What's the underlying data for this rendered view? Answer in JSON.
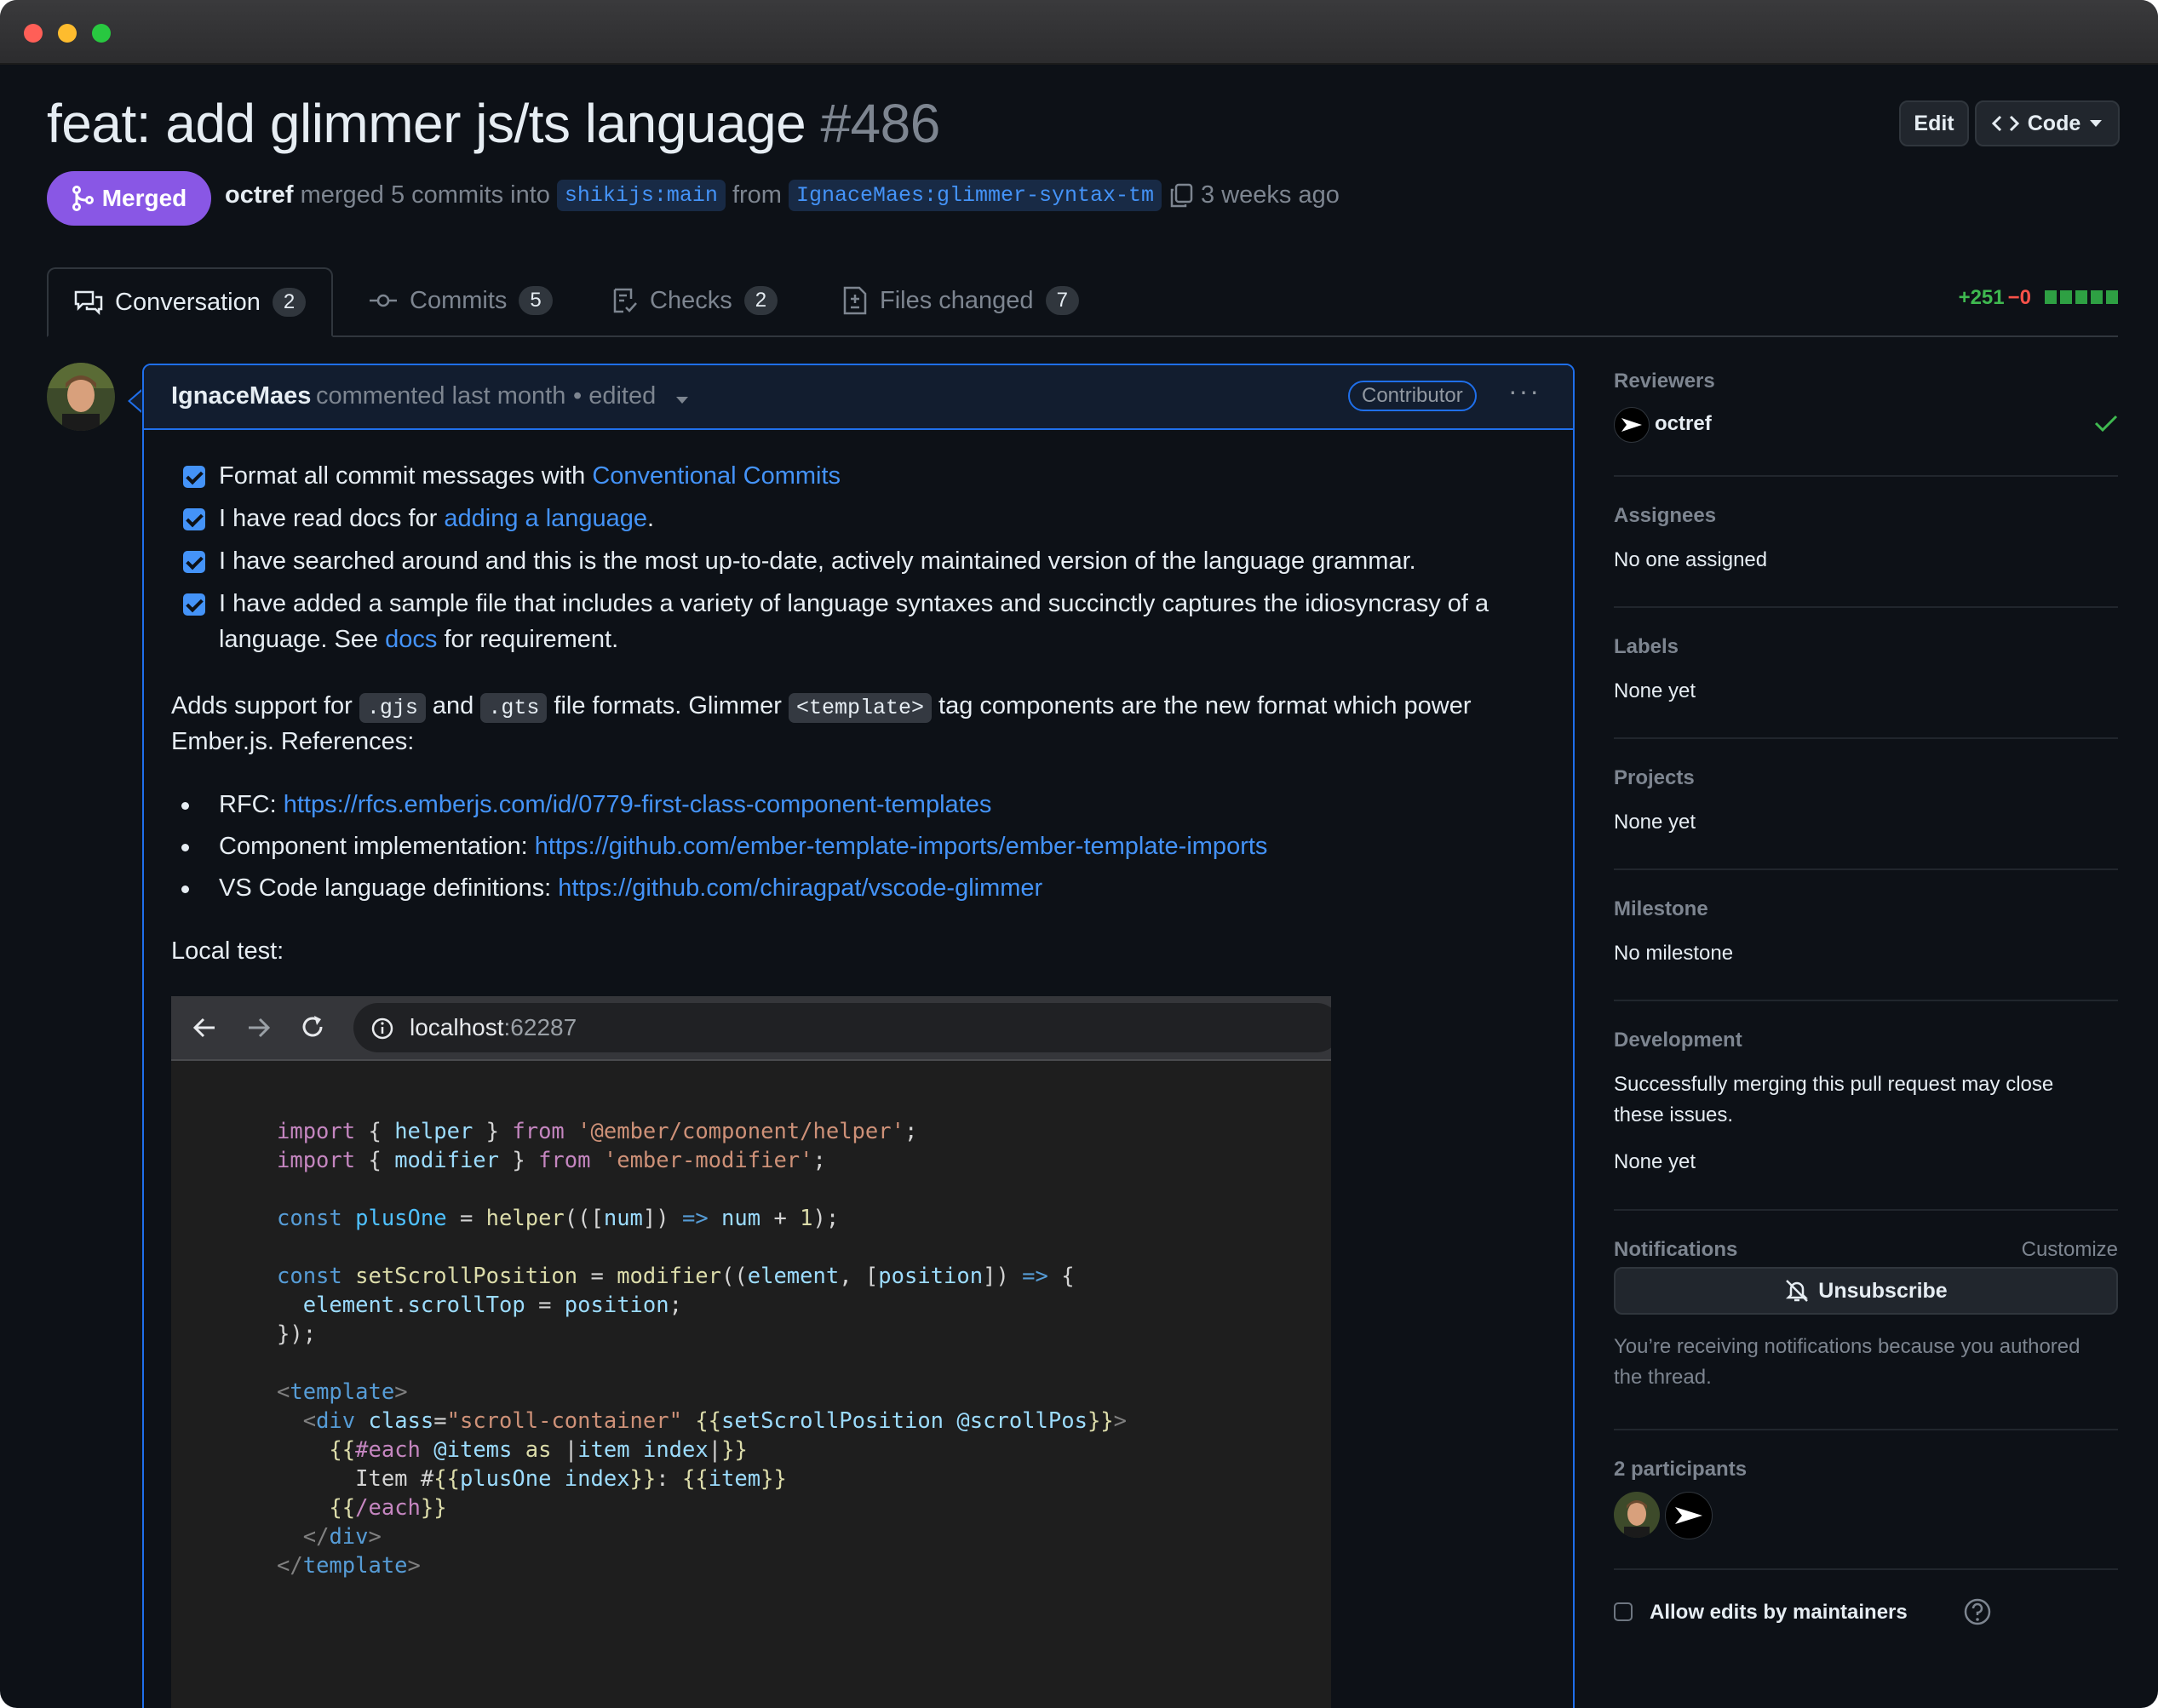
{
  "pr": {
    "title": "feat: add glimmer js/ts language",
    "number": "#486",
    "status": "Merged",
    "author": "octref",
    "merged_text": "merged 5 commits into",
    "base_branch": "shikijs:main",
    "from_text": "from",
    "head_branch": "IgnaceMaes:glimmer-syntax-tm",
    "time": "3 weeks ago"
  },
  "header_buttons": {
    "edit": "Edit",
    "code": "Code"
  },
  "tabs": [
    {
      "label": "Conversation",
      "count": "2"
    },
    {
      "label": "Commits",
      "count": "5"
    },
    {
      "label": "Checks",
      "count": "2"
    },
    {
      "label": "Files changed",
      "count": "7"
    }
  ],
  "diffstat": {
    "additions": "+251",
    "deletions": "−0"
  },
  "comment": {
    "author": "IgnaceMaes",
    "action": "commented last month",
    "edited": "• edited",
    "role": "Contributor",
    "checklist": [
      {
        "text": "Format all commit messages with ",
        "link": "Conventional Commits",
        "after": ""
      },
      {
        "text": "I have read docs for ",
        "link": "adding a language",
        "after": "."
      },
      {
        "text": "I have searched around and this is the most up-to-date, actively maintained version of the language grammar.",
        "link": "",
        "after": ""
      },
      {
        "text": "I have added a sample file that includes a variety of language syntaxes and succinctly captures the idiosyncrasy of a",
        "line2_before": "language. See ",
        "link": "docs",
        "after": " for requirement."
      }
    ],
    "para": {
      "t1": "Adds support for ",
      "c1": ".gjs",
      "t2": " and ",
      "c2": ".gts",
      "t3": " file formats. Glimmer ",
      "c3": "<template>",
      "t4": " tag components are the new format which power",
      "line2": "Ember.js. References:"
    },
    "refs": [
      {
        "label": "RFC: ",
        "url": "https://rfcs.emberjs.com/id/0779-first-class-component-templates"
      },
      {
        "label": "Component implementation: ",
        "url": "https://github.com/ember-template-imports/ember-template-imports"
      },
      {
        "label": "VS Code language definitions: ",
        "url": "https://github.com/chiragpat/vscode-glimmer"
      }
    ],
    "local_test": "Local test:",
    "browser": {
      "host": "localhost",
      "port": ":62287"
    }
  },
  "sidebar": {
    "reviewers": {
      "heading": "Reviewers",
      "name": "octref"
    },
    "assignees": {
      "heading": "Assignees",
      "value": "No one assigned"
    },
    "labels": {
      "heading": "Labels",
      "value": "None yet"
    },
    "projects": {
      "heading": "Projects",
      "value": "None yet"
    },
    "milestone": {
      "heading": "Milestone",
      "value": "No milestone"
    },
    "development": {
      "heading": "Development",
      "line1": "Successfully merging this pull request may close",
      "line2": "these issues.",
      "value": "None yet"
    },
    "notifications": {
      "heading": "Notifications",
      "customize": "Customize",
      "button": "Unsubscribe",
      "note1": "You’re receiving notifications because you authored",
      "note2": "the thread."
    },
    "participants": {
      "heading": "2 participants"
    },
    "allow_edits": "Allow edits by maintainers"
  },
  "colors": {
    "merged": "#8957e5",
    "link": "#4493f8",
    "add": "#3fb950",
    "del": "#f85149"
  }
}
